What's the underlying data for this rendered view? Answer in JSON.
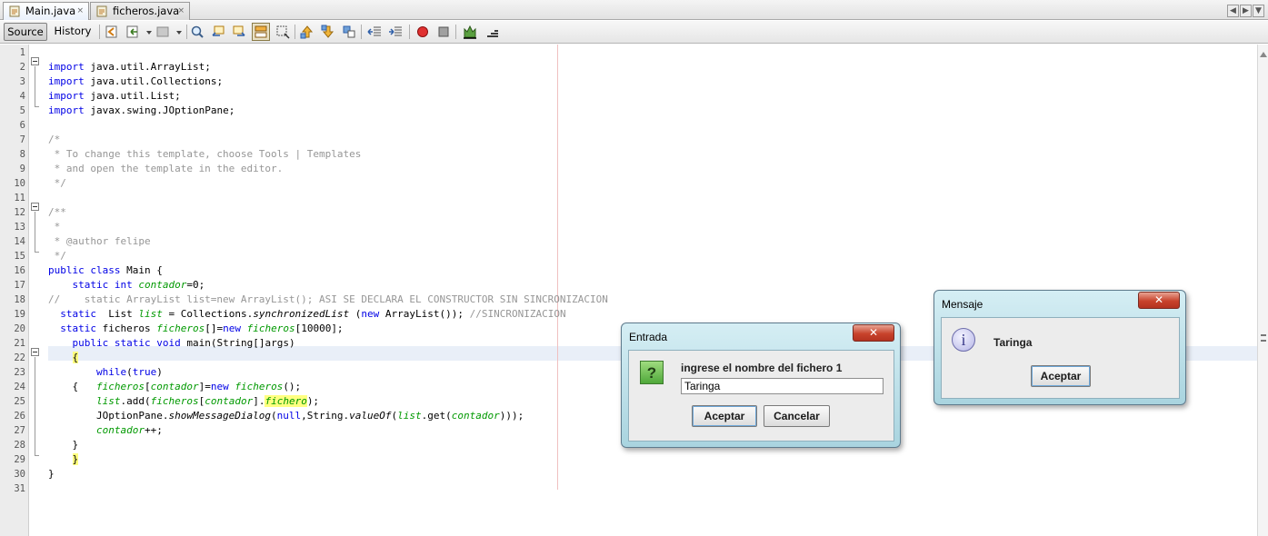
{
  "tabs": [
    {
      "label": "Main.java",
      "active": true
    },
    {
      "label": "ficheros.java",
      "active": false
    }
  ],
  "tab_close_glyph": "×",
  "window_controls": {
    "left": "◀",
    "right": "▶",
    "menu": "▼"
  },
  "toolbar": {
    "source_label": "Source",
    "history_label": "History",
    "icons": [
      "last-edit-icon",
      "back-icon",
      "forward-icon",
      "find-selection-icon",
      "find-previous-icon",
      "find-next-icon",
      "toggle-highlight-icon",
      "toggle-rect-select-icon",
      "previous-bookmark-icon",
      "next-bookmark-icon",
      "toggle-bookmark-icon",
      "shift-left-icon",
      "shift-right-icon",
      "start-macro-icon",
      "stop-macro-icon",
      "comment-icon",
      "uncomment-icon"
    ]
  },
  "editor": {
    "line_numbers": [
      "1",
      "2",
      "3",
      "4",
      "5",
      "6",
      "7",
      "8",
      "9",
      "10",
      "11",
      "12",
      "13",
      "14",
      "15",
      "16",
      "17",
      "18",
      "19",
      "20",
      "21",
      "22",
      "23",
      "24",
      "25",
      "26",
      "27",
      "28",
      "29",
      "30",
      "31"
    ],
    "current_line": 22,
    "code_lines": [
      "",
      "import java.util.ArrayList;",
      "import java.util.Collections;",
      "import java.util.List;",
      "import javax.swing.JOptionPane;",
      "",
      "/*",
      " * To change this template, choose Tools | Templates",
      " * and open the template in the editor.",
      " */",
      "",
      "/**",
      " *",
      " * @author felipe",
      " */",
      "public class Main {",
      "    static int contador=0;",
      "//    static ArrayList list=new ArrayList(); ASI SE DECLARA EL CONSTRUCTOR SIN SINCRONIZACION",
      "  static  List list = Collections.synchronizedList (new ArrayList()); //SINCRONIZACION",
      "  static ficheros ficheros[]=new ficheros[10000];",
      "    public static void main(String[]args)",
      "    {",
      "        while(true)",
      "    {   ficheros[contador]=new ficheros();",
      "        list.add(ficheros[contador].fichero);",
      "        JOptionPane.showMessageDialog(null,String.valueOf(list.get(contador)));",
      "        contador++;",
      "    }",
      "    }",
      "}",
      ""
    ]
  },
  "dialog_entrada": {
    "title": "Entrada",
    "close_glyph": "✕",
    "icon": "question-icon",
    "icon_glyph": "?",
    "prompt": "ingrese el nombre del fichero 1",
    "input_value": "Taringa",
    "ok_label": "Aceptar",
    "cancel_label": "Cancelar"
  },
  "dialog_mensaje": {
    "title": "Mensaje",
    "close_glyph": "✕",
    "icon": "information-icon",
    "icon_glyph": "i",
    "message": "Taringa",
    "ok_label": "Aceptar"
  },
  "colors": {
    "keyword": "#0000e6",
    "comment": "#969696",
    "field": "#009900",
    "brace_highlight": "#ffff80",
    "current_line": "#e9eff8",
    "dialog_frame": "#a9d4df",
    "close_button": "#c8432c"
  }
}
